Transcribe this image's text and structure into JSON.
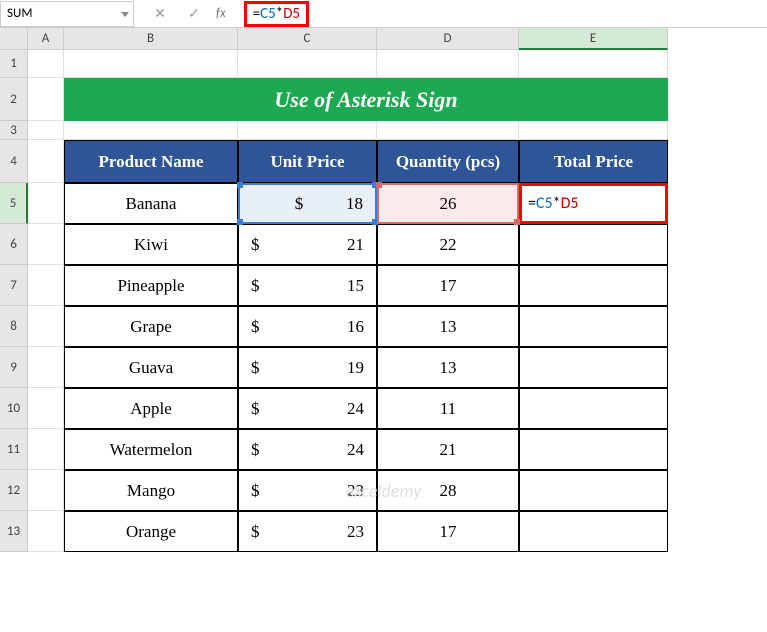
{
  "namebox": "SUM",
  "formula": {
    "eq": "=",
    "c5": "C5",
    "star": "*",
    "d5": "D5"
  },
  "columns": [
    "A",
    "B",
    "C",
    "D",
    "E"
  ],
  "rownums": [
    "1",
    "2",
    "3",
    "4",
    "5",
    "6",
    "7",
    "8",
    "9",
    "10",
    "11",
    "12",
    "13"
  ],
  "title": "Use of Asterisk Sign",
  "headers": {
    "b": "Product Name",
    "c": "Unit Price",
    "d": "Quantity (pcs)",
    "e": "Total Price"
  },
  "chart_data": {
    "type": "table",
    "columns": [
      "Product Name",
      "Unit Price",
      "Quantity (pcs)",
      "Total Price"
    ],
    "rows": [
      {
        "product": "Banana",
        "currency": "$",
        "price": 18,
        "qty": 26,
        "total": "=C5*D5"
      },
      {
        "product": "Kiwi",
        "currency": "$",
        "price": 21,
        "qty": 22,
        "total": ""
      },
      {
        "product": "Pineapple",
        "currency": "$",
        "price": 15,
        "qty": 17,
        "total": ""
      },
      {
        "product": "Grape",
        "currency": "$",
        "price": 16,
        "qty": 13,
        "total": ""
      },
      {
        "product": "Guava",
        "currency": "$",
        "price": 19,
        "qty": 13,
        "total": ""
      },
      {
        "product": "Apple",
        "currency": "$",
        "price": 24,
        "qty": 11,
        "total": ""
      },
      {
        "product": "Watermelon",
        "currency": "$",
        "price": 24,
        "qty": 21,
        "total": ""
      },
      {
        "product": "Mango",
        "currency": "$",
        "price": 23,
        "qty": 28,
        "total": ""
      },
      {
        "product": "Orange",
        "currency": "$",
        "price": 23,
        "qty": 17,
        "total": ""
      }
    ]
  },
  "watermark": "exceldemy"
}
